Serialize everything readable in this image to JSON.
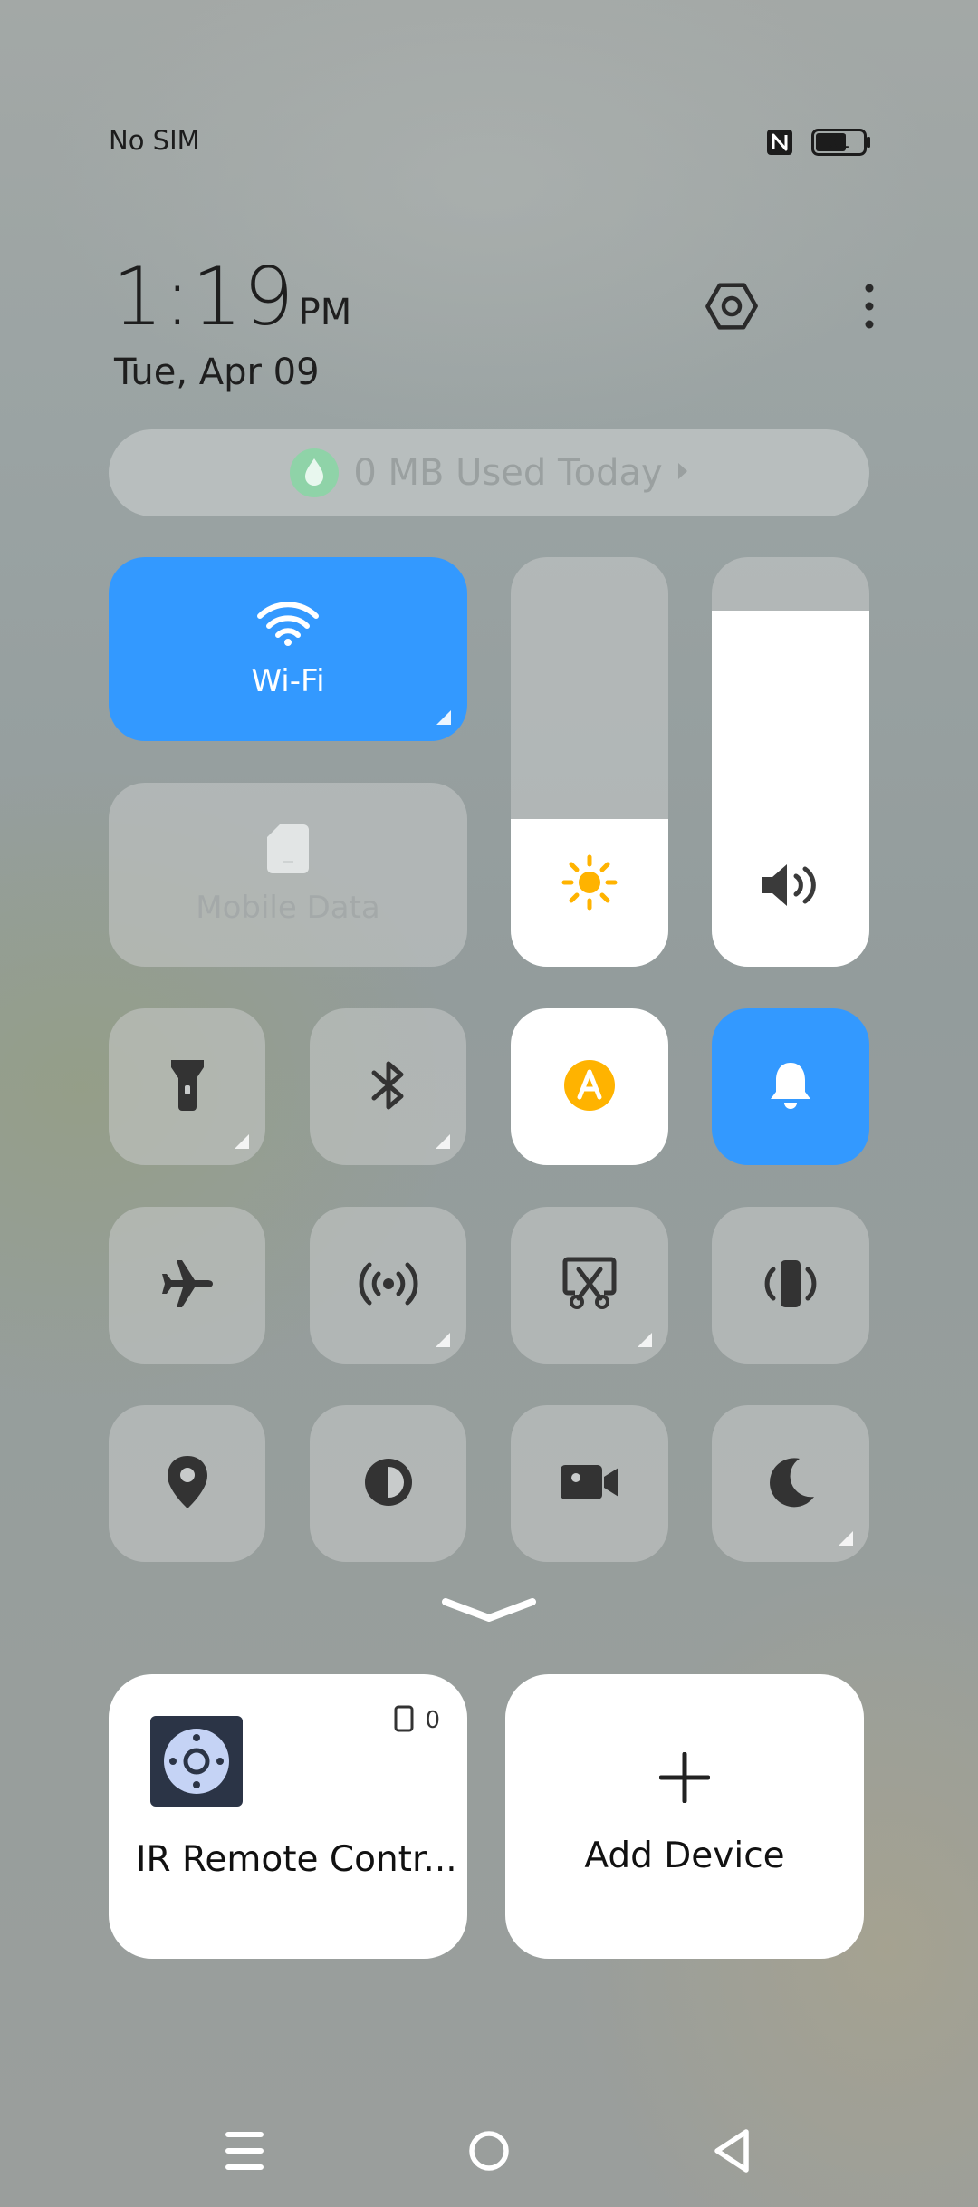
{
  "status_bar": {
    "carrier": "No SIM",
    "battery": "61"
  },
  "header": {
    "time": "1:19",
    "ampm": "PM",
    "date": "Tue, Apr 09"
  },
  "data_usage": {
    "label": "0 MB Used Today"
  },
  "tiles": {
    "wifi": {
      "label": "Wi-Fi",
      "state": "on"
    },
    "mobile_data": {
      "label": "Mobile Data",
      "state": "off"
    }
  },
  "sliders": {
    "brightness_level": 0.36,
    "volume_level": 0.87
  },
  "devices": {
    "ir_remote": {
      "label": "IR Remote Contr...",
      "count": "0"
    },
    "add_device": {
      "label": "Add Device"
    }
  },
  "colors": {
    "accent": "#3399ff",
    "sun": "#ffb300",
    "auto_brightness": "#ffb300"
  }
}
